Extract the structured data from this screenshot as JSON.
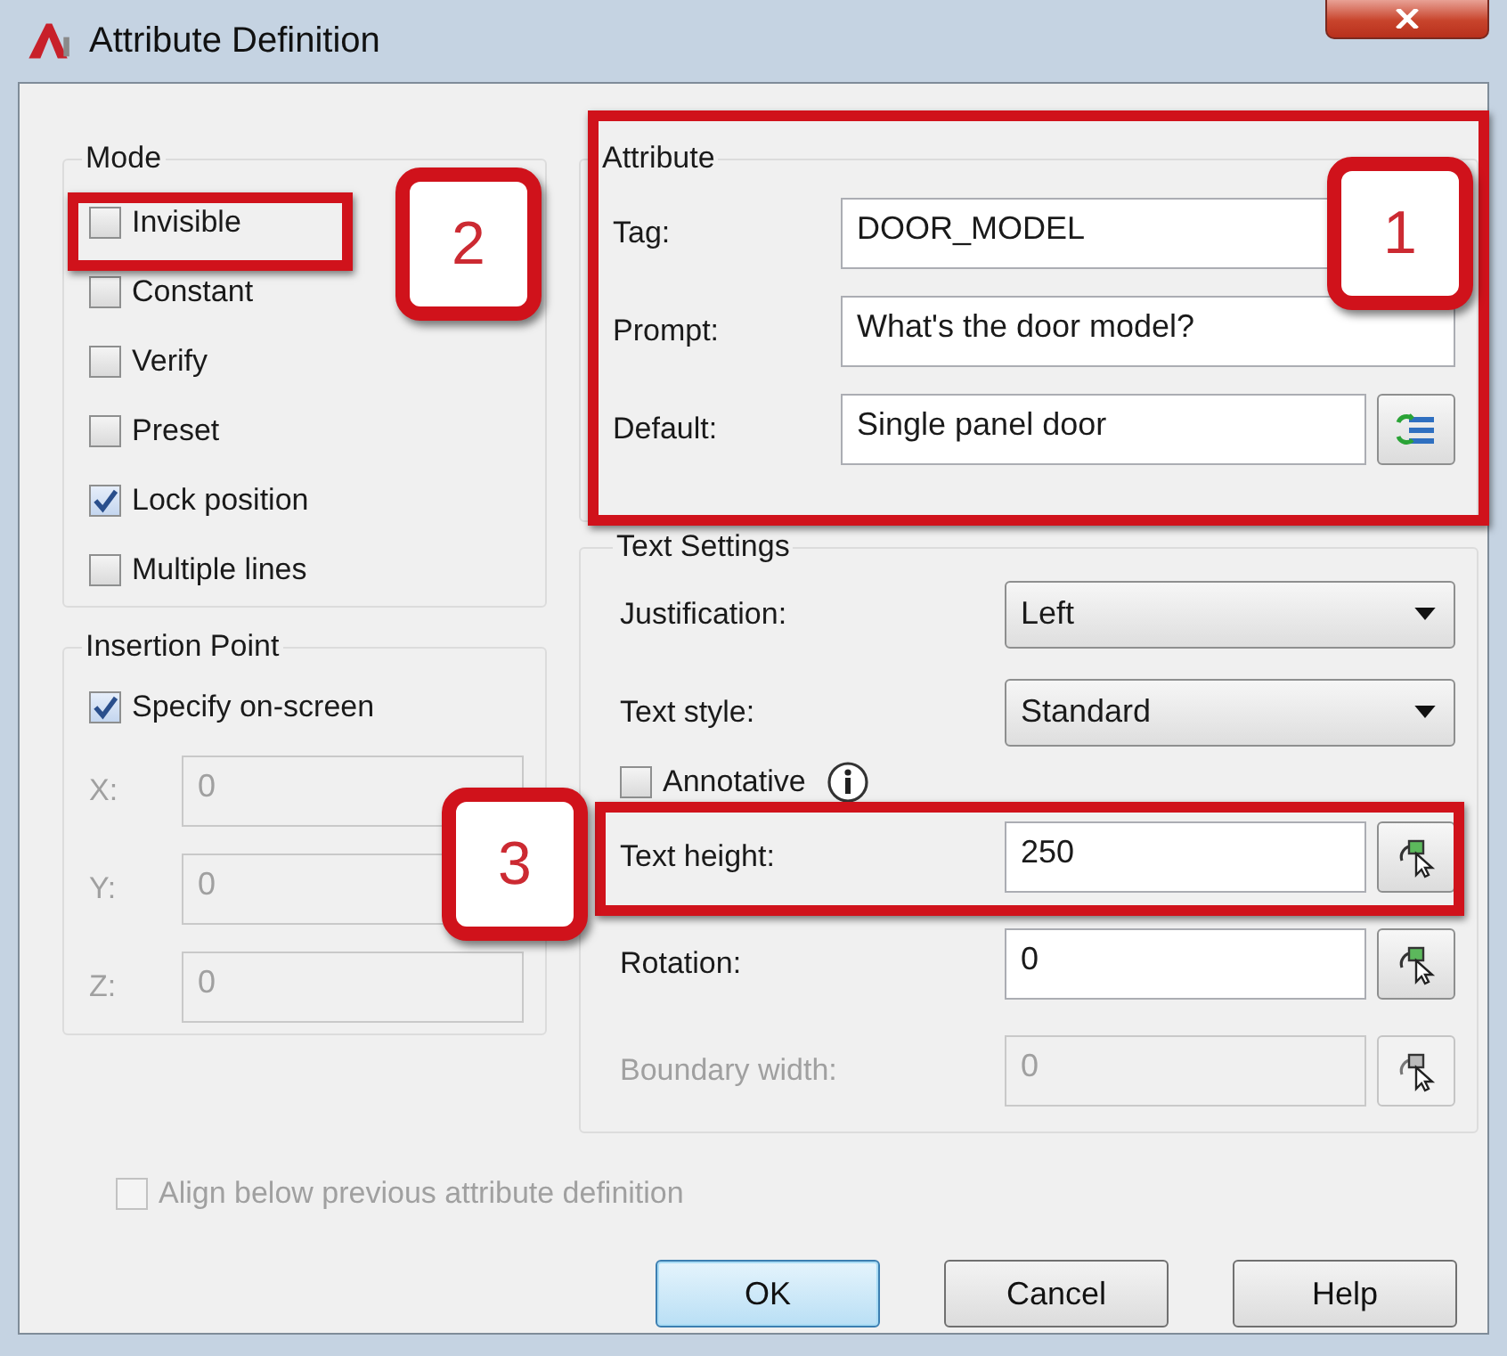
{
  "window": {
    "title": "Attribute Definition"
  },
  "mode": {
    "title": "Mode",
    "options": [
      {
        "label": "Invisible",
        "checked": false
      },
      {
        "label": "Constant",
        "checked": false
      },
      {
        "label": "Verify",
        "checked": false
      },
      {
        "label": "Preset",
        "checked": false
      },
      {
        "label": "Lock position",
        "checked": true
      },
      {
        "label": "Multiple lines",
        "checked": false
      }
    ]
  },
  "insertion_point": {
    "title": "Insertion Point",
    "specify_on_screen": {
      "label": "Specify on-screen",
      "checked": true
    },
    "coordinates": [
      {
        "label": "X:",
        "value": "0",
        "disabled": true
      },
      {
        "label": "Y:",
        "value": "0",
        "disabled": true
      },
      {
        "label": "Z:",
        "value": "0",
        "disabled": true
      }
    ]
  },
  "attribute": {
    "title": "Attribute",
    "fields": [
      {
        "kind": "text",
        "label": "Tag:",
        "value": "DOOR_MODEL"
      },
      {
        "kind": "text",
        "label": "Prompt:",
        "value": "What's the door model?"
      },
      {
        "kind": "field-button",
        "label": "Default:",
        "value": "Single panel door"
      }
    ]
  },
  "text_settings": {
    "title": "Text Settings",
    "rows": [
      {
        "kind": "dropdown",
        "label": "Justification:",
        "value": "Left"
      },
      {
        "kind": "dropdown",
        "label": "Text style:",
        "value": "Standard"
      },
      {
        "kind": "checkbox",
        "label": "Annotative",
        "checked": false
      },
      {
        "kind": "pick",
        "label": "Text height:",
        "value": "250",
        "disabled": false
      },
      {
        "kind": "pick",
        "label": "Rotation:",
        "value": "0",
        "disabled": false
      },
      {
        "kind": "pick",
        "label": "Boundary width:",
        "value": "0",
        "disabled": true
      }
    ]
  },
  "align_below": {
    "label": "Align below previous attribute definition",
    "checked": false,
    "disabled": true
  },
  "buttons": [
    {
      "label": "OK",
      "default": true
    },
    {
      "label": "Cancel",
      "default": false
    },
    {
      "label": "Help",
      "default": false
    }
  ],
  "annotations": [
    {
      "number": "1"
    },
    {
      "number": "2"
    },
    {
      "number": "3"
    }
  ]
}
